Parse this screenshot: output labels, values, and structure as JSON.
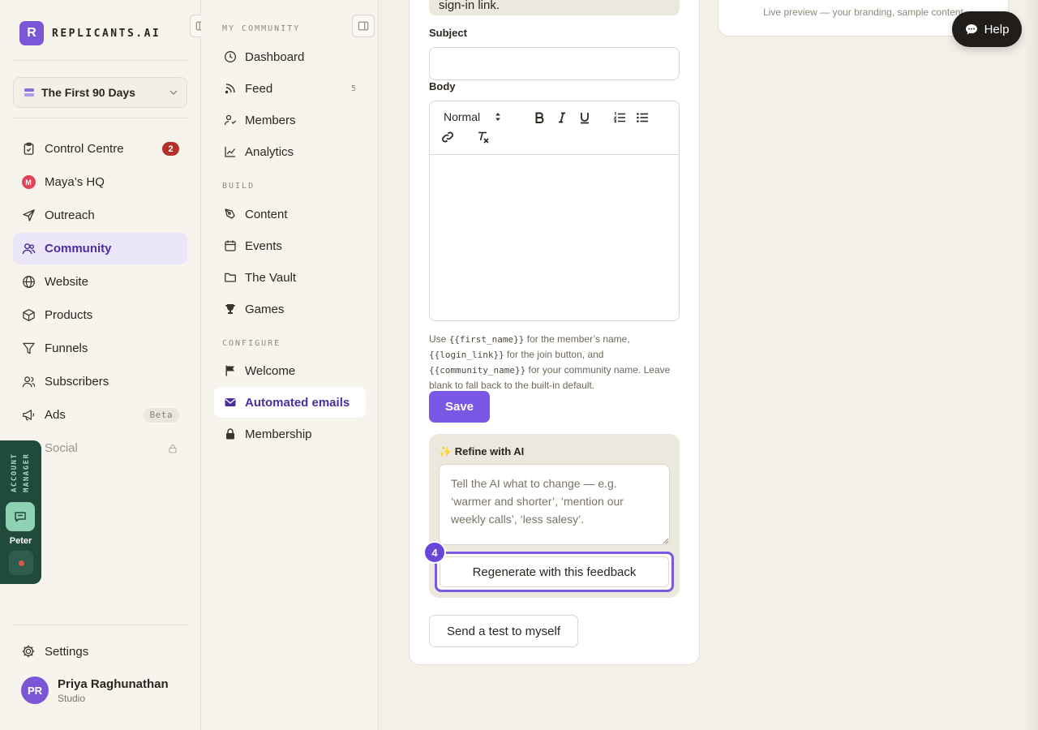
{
  "brand": {
    "mark": "R",
    "name": "REPLICANTS.AI"
  },
  "workspace": {
    "label": "The First 90 Days"
  },
  "nav": {
    "items": [
      {
        "label": "Control Centre",
        "icon": "clipboard-icon",
        "badge": "2"
      },
      {
        "label": "Maya’s HQ",
        "icon": "maya-avatar-icon",
        "avatar_letter": "M"
      },
      {
        "label": "Outreach",
        "icon": "send-icon"
      },
      {
        "label": "Community",
        "icon": "users-icon",
        "active": true
      },
      {
        "label": "Website",
        "icon": "globe-icon"
      },
      {
        "label": "Products",
        "icon": "box-icon"
      },
      {
        "label": "Funnels",
        "icon": "funnel-icon"
      },
      {
        "label": "Subscribers",
        "icon": "user-group-icon"
      },
      {
        "label": "Ads",
        "icon": "megaphone-icon",
        "tag": "Beta"
      },
      {
        "label": "Social",
        "icon": "social-icon",
        "locked": true
      }
    ],
    "settings_label": "Settings"
  },
  "user": {
    "initials": "PR",
    "name": "Priya Raghunathan",
    "role": "Studio"
  },
  "account_manager": {
    "label": "ACCOUNT MANAGER",
    "name": "Peter"
  },
  "subnav": {
    "sections": [
      {
        "title": "MY COMMUNITY"
      },
      {
        "title": "BUILD"
      },
      {
        "title": "CONFIGURE"
      }
    ],
    "items": [
      {
        "label": "Dashboard"
      },
      {
        "label": "Feed",
        "count": "5"
      },
      {
        "label": "Members"
      },
      {
        "label": "Analytics"
      },
      {
        "label": "Content"
      },
      {
        "label": "Events"
      },
      {
        "label": "The Vault"
      },
      {
        "label": "Games"
      },
      {
        "label": "Welcome"
      },
      {
        "label": "Automated emails",
        "active": true
      },
      {
        "label": "Membership"
      }
    ]
  },
  "editor": {
    "info_fragment": "sign-in link.",
    "subject_label": "Subject",
    "subject_value": "",
    "body_label": "Body",
    "format_select": "Normal",
    "help": {
      "p1": "Use ",
      "var1": "{{first_name}}",
      "p2": " for the member’s name, ",
      "var2": "{{login_link}}",
      "p3": " for the join button, and ",
      "var3": "{{community_name}}",
      "p4": " for your community name. Leave blank to fall back to the built-in default."
    },
    "save_label": "Save",
    "refine": {
      "title": "✨ Refine with AI",
      "placeholder": "Tell the AI what to change — e.g. ‘warmer and shorter’, ‘mention our weekly calls’, ‘less salesy’.",
      "regenerate_label": "Regenerate with this feedback",
      "step": "4"
    },
    "test_label": "Send a test to myself"
  },
  "preview": {
    "note": "Live preview — your branding, sample content"
  },
  "help_button": {
    "label": "Help"
  },
  "colors": {
    "accent": "#7b57e6",
    "badge": "#b5302a",
    "active_bg": "#ece7f8",
    "account_manager_bg": "#1f4a3c"
  }
}
